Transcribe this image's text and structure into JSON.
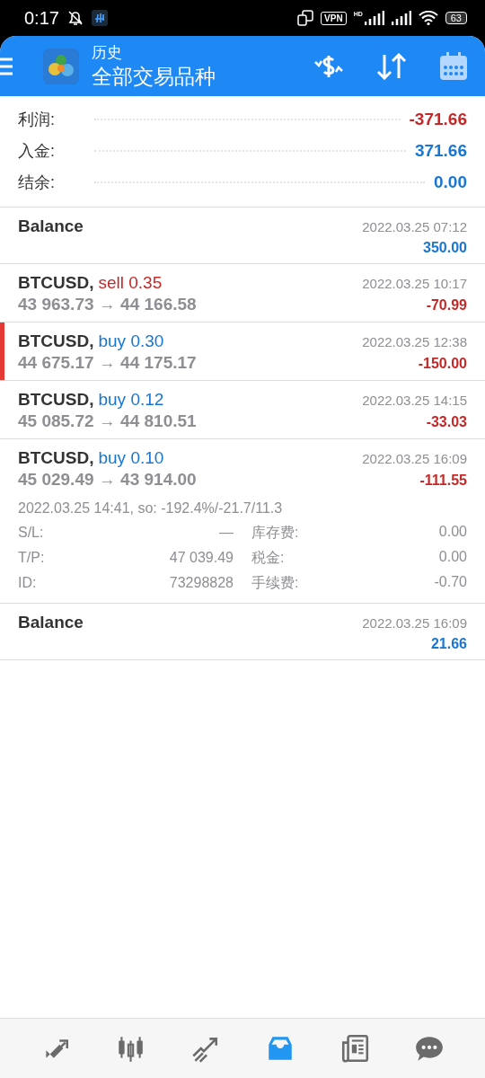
{
  "status_bar": {
    "time": "0:17",
    "vpn": "VPN",
    "hd": "HD",
    "battery": "63"
  },
  "header": {
    "subtitle": "历史",
    "title": "全部交易品种"
  },
  "summary": [
    {
      "label": "利润:",
      "value": "-371.66",
      "color": "#c62828"
    },
    {
      "label": "入金:",
      "value": "371.66",
      "color": "#1976d2"
    },
    {
      "label": "结余:",
      "value": "0.00",
      "color": "#1976d2"
    }
  ],
  "entries": [
    {
      "kind": "balance",
      "title": "Balance",
      "time": "2022.03.25 07:12",
      "amount": "350.00",
      "color": "#1976d2",
      "selected": false
    },
    {
      "kind": "trade",
      "symbol": "BTCUSD,",
      "side": "sell",
      "volume": "0.35",
      "prices": "43 963.73 → 44 166.58",
      "time": "2022.03.25 10:17",
      "amount": "-70.99",
      "color": "#c62828",
      "selected": false
    },
    {
      "kind": "trade",
      "symbol": "BTCUSD,",
      "side": "buy",
      "volume": "0.30",
      "prices": "44 675.17 → 44 175.17",
      "time": "2022.03.25 12:38",
      "amount": "-150.00",
      "color": "#c62828",
      "selected": true
    },
    {
      "kind": "trade",
      "symbol": "BTCUSD,",
      "side": "buy",
      "volume": "0.12",
      "prices": "45 085.72 → 44 810.51",
      "time": "2022.03.25 14:15",
      "amount": "-33.03",
      "color": "#c62828",
      "selected": false
    },
    {
      "kind": "trade",
      "symbol": "BTCUSD,",
      "side": "buy",
      "volume": "0.10",
      "prices": "45 029.49 → 43 914.00",
      "time": "2022.03.25 16:09",
      "amount": "-111.55",
      "color": "#c62828",
      "selected": false,
      "details": {
        "open_info": "2022.03.25 14:41, so: -192.4%/-21.7/11.3",
        "rows": [
          {
            "left_label": "S/L:",
            "left_value": "—",
            "right_label": "库存费:",
            "right_value": "0.00"
          },
          {
            "left_label": "T/P:",
            "left_value": "47 039.49",
            "right_label": "税金:",
            "right_value": "0.00"
          },
          {
            "left_label": "ID:",
            "left_value": "73298828",
            "right_label": "手续费:",
            "right_value": "-0.70"
          }
        ]
      }
    },
    {
      "kind": "balance",
      "title": "Balance",
      "time": "2022.03.25 16:09",
      "amount": "21.66",
      "color": "#1976d2",
      "selected": false
    }
  ],
  "nav": [
    {
      "kind": "trade",
      "selected": false
    },
    {
      "kind": "candles",
      "selected": false
    },
    {
      "kind": "trend",
      "selected": false
    },
    {
      "kind": "inbox",
      "selected": true
    },
    {
      "kind": "news",
      "selected": false
    },
    {
      "kind": "chat",
      "selected": false
    }
  ]
}
